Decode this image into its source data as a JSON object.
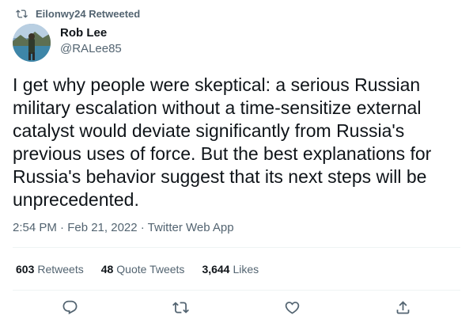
{
  "retweet_context": {
    "icon": "retweet-icon",
    "text": "Eilonwy24 Retweeted"
  },
  "author": {
    "display_name": "Rob Lee",
    "handle": "@RALee85",
    "avatar_icon": "avatar-photo"
  },
  "tweet": {
    "text_lines": [
      "I get why people were skeptical: a serious Russian",
      "military escalation without a time-sensitize external",
      "catalyst would deviate significantly from Russia's",
      "previous uses of force. But the best explanations for",
      "Russia's behavior suggest that its next steps will be",
      "unprecedented."
    ],
    "meta": "2:54 PM · Feb 21, 2022 · Twitter Web App"
  },
  "stats": [
    {
      "count": "603",
      "label": "Retweets"
    },
    {
      "count": "48",
      "label": "Quote Tweets"
    },
    {
      "count": "3,644",
      "label": "Likes"
    }
  ],
  "actions": [
    {
      "name": "reply",
      "icon": "reply-icon"
    },
    {
      "name": "retweet",
      "icon": "retweet-icon"
    },
    {
      "name": "like",
      "icon": "heart-icon"
    },
    {
      "name": "share",
      "icon": "share-icon"
    }
  ],
  "colors": {
    "text_primary": "#0f1419",
    "text_secondary": "#536471",
    "divider": "#eff3f4"
  }
}
